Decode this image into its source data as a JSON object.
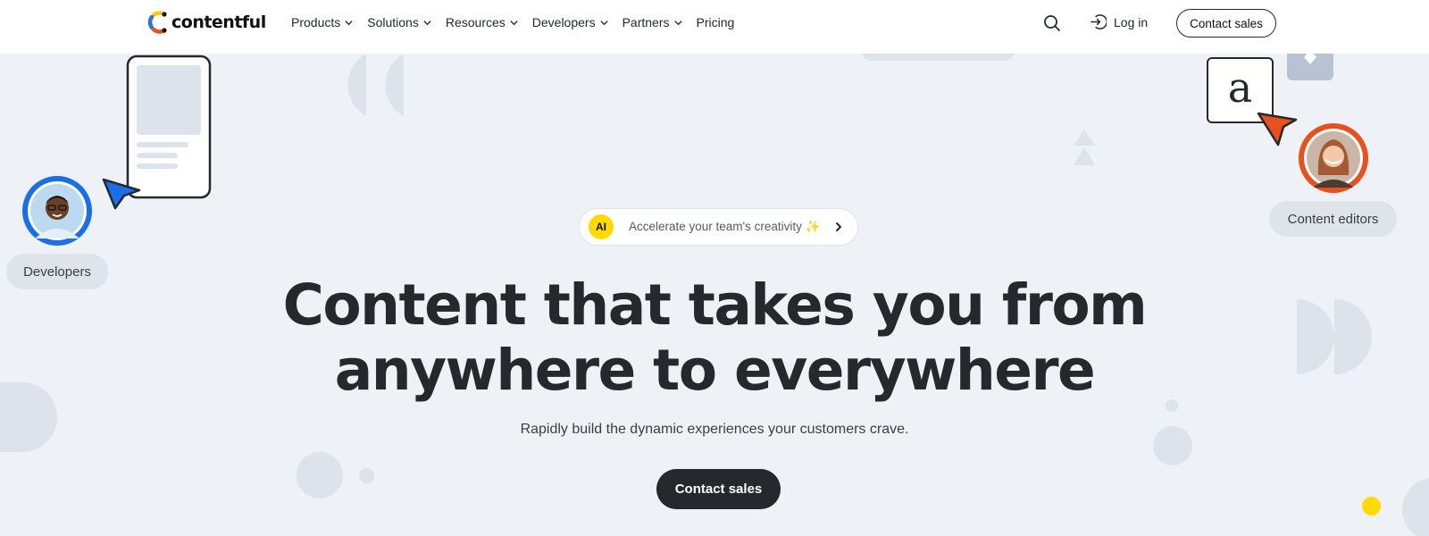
{
  "header": {
    "logo_text": "contentful",
    "nav": [
      {
        "label": "Products",
        "has_dropdown": true
      },
      {
        "label": "Solutions",
        "has_dropdown": true
      },
      {
        "label": "Resources",
        "has_dropdown": true
      },
      {
        "label": "Developers",
        "has_dropdown": true
      },
      {
        "label": "Partners",
        "has_dropdown": true
      },
      {
        "label": "Pricing",
        "has_dropdown": false
      }
    ],
    "login_label": "Log in",
    "contact_label": "Contact sales"
  },
  "hero": {
    "ai_badge": "AI",
    "ai_text": "Accelerate your team's creativity ✨",
    "headline_line1": "Content that takes you from",
    "headline_line2": "anywhere to everywhere",
    "subline": "Rapidly build the dynamic experiences your customers crave.",
    "cta_label": "Contact sales"
  },
  "personas": {
    "developers_label": "Developers",
    "editors_label": "Content editors",
    "editor_card_letter": "a"
  },
  "icons": {
    "search": "search-icon",
    "login": "login-arrow-icon",
    "chevron": "chevron-down-icon",
    "ai_chevron": "chevron-right-icon"
  },
  "colors": {
    "background": "#eef1f5",
    "text_dark": "#25282d",
    "accent_blue": "#1a6ee8",
    "accent_orange": "#e8501e",
    "accent_yellow": "#ffda00",
    "shape_gray": "#dde3eb"
  }
}
